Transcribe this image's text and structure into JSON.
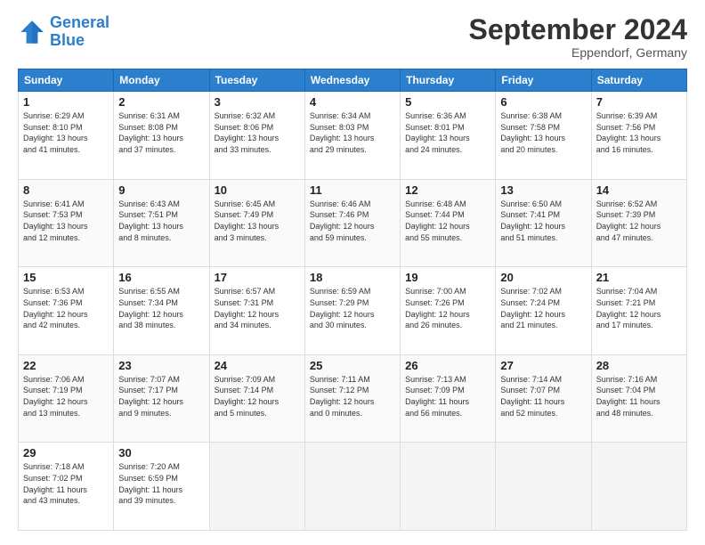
{
  "logo": {
    "general": "General",
    "blue": "Blue"
  },
  "title": "September 2024",
  "subtitle": "Eppendorf, Germany",
  "headers": [
    "Sunday",
    "Monday",
    "Tuesday",
    "Wednesday",
    "Thursday",
    "Friday",
    "Saturday"
  ],
  "weeks": [
    [
      {
        "day": "1",
        "lines": [
          "Sunrise: 6:29 AM",
          "Sunset: 8:10 PM",
          "Daylight: 13 hours",
          "and 41 minutes."
        ]
      },
      {
        "day": "2",
        "lines": [
          "Sunrise: 6:31 AM",
          "Sunset: 8:08 PM",
          "Daylight: 13 hours",
          "and 37 minutes."
        ]
      },
      {
        "day": "3",
        "lines": [
          "Sunrise: 6:32 AM",
          "Sunset: 8:06 PM",
          "Daylight: 13 hours",
          "and 33 minutes."
        ]
      },
      {
        "day": "4",
        "lines": [
          "Sunrise: 6:34 AM",
          "Sunset: 8:03 PM",
          "Daylight: 13 hours",
          "and 29 minutes."
        ]
      },
      {
        "day": "5",
        "lines": [
          "Sunrise: 6:36 AM",
          "Sunset: 8:01 PM",
          "Daylight: 13 hours",
          "and 24 minutes."
        ]
      },
      {
        "day": "6",
        "lines": [
          "Sunrise: 6:38 AM",
          "Sunset: 7:58 PM",
          "Daylight: 13 hours",
          "and 20 minutes."
        ]
      },
      {
        "day": "7",
        "lines": [
          "Sunrise: 6:39 AM",
          "Sunset: 7:56 PM",
          "Daylight: 13 hours",
          "and 16 minutes."
        ]
      }
    ],
    [
      {
        "day": "8",
        "lines": [
          "Sunrise: 6:41 AM",
          "Sunset: 7:53 PM",
          "Daylight: 13 hours",
          "and 12 minutes."
        ]
      },
      {
        "day": "9",
        "lines": [
          "Sunrise: 6:43 AM",
          "Sunset: 7:51 PM",
          "Daylight: 13 hours",
          "and 8 minutes."
        ]
      },
      {
        "day": "10",
        "lines": [
          "Sunrise: 6:45 AM",
          "Sunset: 7:49 PM",
          "Daylight: 13 hours",
          "and 3 minutes."
        ]
      },
      {
        "day": "11",
        "lines": [
          "Sunrise: 6:46 AM",
          "Sunset: 7:46 PM",
          "Daylight: 12 hours",
          "and 59 minutes."
        ]
      },
      {
        "day": "12",
        "lines": [
          "Sunrise: 6:48 AM",
          "Sunset: 7:44 PM",
          "Daylight: 12 hours",
          "and 55 minutes."
        ]
      },
      {
        "day": "13",
        "lines": [
          "Sunrise: 6:50 AM",
          "Sunset: 7:41 PM",
          "Daylight: 12 hours",
          "and 51 minutes."
        ]
      },
      {
        "day": "14",
        "lines": [
          "Sunrise: 6:52 AM",
          "Sunset: 7:39 PM",
          "Daylight: 12 hours",
          "and 47 minutes."
        ]
      }
    ],
    [
      {
        "day": "15",
        "lines": [
          "Sunrise: 6:53 AM",
          "Sunset: 7:36 PM",
          "Daylight: 12 hours",
          "and 42 minutes."
        ]
      },
      {
        "day": "16",
        "lines": [
          "Sunrise: 6:55 AM",
          "Sunset: 7:34 PM",
          "Daylight: 12 hours",
          "and 38 minutes."
        ]
      },
      {
        "day": "17",
        "lines": [
          "Sunrise: 6:57 AM",
          "Sunset: 7:31 PM",
          "Daylight: 12 hours",
          "and 34 minutes."
        ]
      },
      {
        "day": "18",
        "lines": [
          "Sunrise: 6:59 AM",
          "Sunset: 7:29 PM",
          "Daylight: 12 hours",
          "and 30 minutes."
        ]
      },
      {
        "day": "19",
        "lines": [
          "Sunrise: 7:00 AM",
          "Sunset: 7:26 PM",
          "Daylight: 12 hours",
          "and 26 minutes."
        ]
      },
      {
        "day": "20",
        "lines": [
          "Sunrise: 7:02 AM",
          "Sunset: 7:24 PM",
          "Daylight: 12 hours",
          "and 21 minutes."
        ]
      },
      {
        "day": "21",
        "lines": [
          "Sunrise: 7:04 AM",
          "Sunset: 7:21 PM",
          "Daylight: 12 hours",
          "and 17 minutes."
        ]
      }
    ],
    [
      {
        "day": "22",
        "lines": [
          "Sunrise: 7:06 AM",
          "Sunset: 7:19 PM",
          "Daylight: 12 hours",
          "and 13 minutes."
        ]
      },
      {
        "day": "23",
        "lines": [
          "Sunrise: 7:07 AM",
          "Sunset: 7:17 PM",
          "Daylight: 12 hours",
          "and 9 minutes."
        ]
      },
      {
        "day": "24",
        "lines": [
          "Sunrise: 7:09 AM",
          "Sunset: 7:14 PM",
          "Daylight: 12 hours",
          "and 5 minutes."
        ]
      },
      {
        "day": "25",
        "lines": [
          "Sunrise: 7:11 AM",
          "Sunset: 7:12 PM",
          "Daylight: 12 hours",
          "and 0 minutes."
        ]
      },
      {
        "day": "26",
        "lines": [
          "Sunrise: 7:13 AM",
          "Sunset: 7:09 PM",
          "Daylight: 11 hours",
          "and 56 minutes."
        ]
      },
      {
        "day": "27",
        "lines": [
          "Sunrise: 7:14 AM",
          "Sunset: 7:07 PM",
          "Daylight: 11 hours",
          "and 52 minutes."
        ]
      },
      {
        "day": "28",
        "lines": [
          "Sunrise: 7:16 AM",
          "Sunset: 7:04 PM",
          "Daylight: 11 hours",
          "and 48 minutes."
        ]
      }
    ],
    [
      {
        "day": "29",
        "lines": [
          "Sunrise: 7:18 AM",
          "Sunset: 7:02 PM",
          "Daylight: 11 hours",
          "and 43 minutes."
        ]
      },
      {
        "day": "30",
        "lines": [
          "Sunrise: 7:20 AM",
          "Sunset: 6:59 PM",
          "Daylight: 11 hours",
          "and 39 minutes."
        ]
      },
      {
        "day": "",
        "lines": [],
        "empty": true
      },
      {
        "day": "",
        "lines": [],
        "empty": true
      },
      {
        "day": "",
        "lines": [],
        "empty": true
      },
      {
        "day": "",
        "lines": [],
        "empty": true
      },
      {
        "day": "",
        "lines": [],
        "empty": true
      }
    ]
  ]
}
